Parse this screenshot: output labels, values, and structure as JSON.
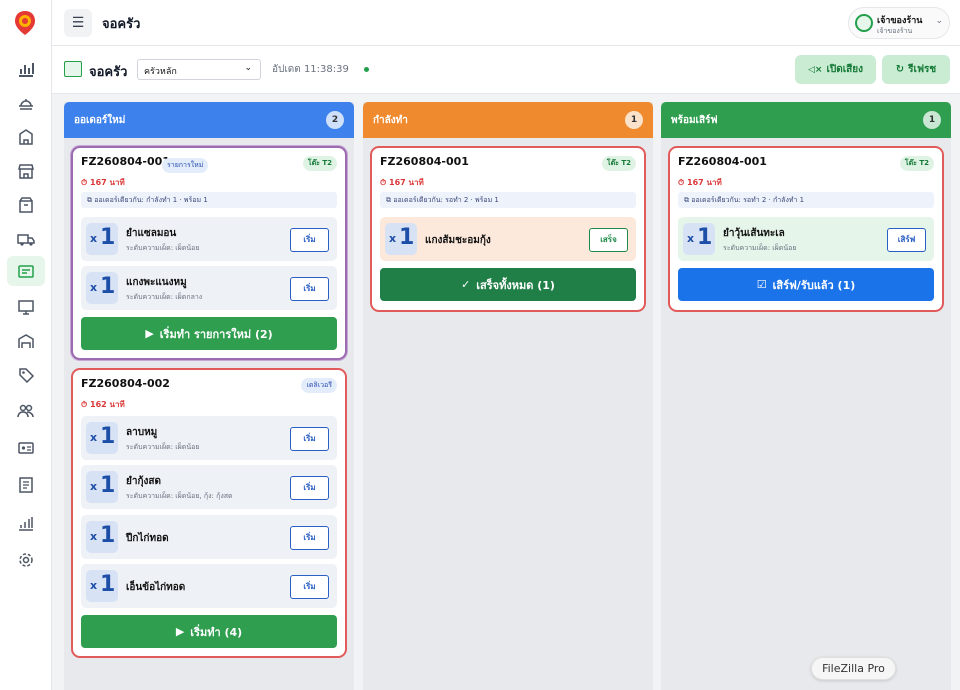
{
  "header": {
    "title": "จอครัว",
    "user_name": "เจ้าของร้าน",
    "user_role": "เจ้าของร้าน"
  },
  "toolbar": {
    "title": "จอครัว",
    "kitchen_select": "ครัวหลัก",
    "update_text": "อัปเดต 11:38:39",
    "sound_button": "เปิดเสียง",
    "refresh_button": "รีเฟรช"
  },
  "colors": {
    "new": "#3d82ec",
    "cooking": "#f08a2e",
    "ready": "#2f9e4f"
  },
  "columns": {
    "new": {
      "title": "ออเดอร์ใหม่",
      "count": "2",
      "orders": [
        {
          "number": "FZ260804-001",
          "badge": "รายการใหม่",
          "table": "โต๊ะ T2",
          "time": "167 นาที",
          "shared_note": "ออเดอร์เดียวกัน: กำลังทำ 1 · พร้อม 1",
          "items": [
            {
              "qty": "1",
              "name": "ยำแซลมอน",
              "note": "ระดับความเผ็ด: เผ็ดน้อย",
              "action": "เริ่ม"
            },
            {
              "qty": "1",
              "name": "แกงพะแนงหมู",
              "note": "ระดับความเผ็ด: เผ็ดกลาง",
              "action": "เริ่ม"
            }
          ],
          "main_action": "เริ่มทำ รายการใหม่ (2)"
        },
        {
          "number": "FZ260804-002",
          "badge": "เดลิเวอรี",
          "time": "162 นาที",
          "items": [
            {
              "qty": "1",
              "name": "ลาบหมู",
              "note": "ระดับความเผ็ด: เผ็ดน้อย",
              "action": "เริ่ม"
            },
            {
              "qty": "1",
              "name": "ยำกุ้งสด",
              "note": "ระดับความเผ็ด: เผ็ดน้อย, กุ้ง: กุ้งสด",
              "action": "เริ่ม"
            },
            {
              "qty": "1",
              "name": "ปีกไก่ทอด",
              "action": "เริ่ม"
            },
            {
              "qty": "1",
              "name": "เอ็นข้อไก่ทอด",
              "action": "เริ่ม"
            }
          ],
          "main_action": "เริ่มทำ (4)"
        }
      ]
    },
    "cooking": {
      "title": "กำลังทำ",
      "count": "1",
      "order": {
        "number": "FZ260804-001",
        "table": "โต๊ะ T2",
        "time": "167 นาที",
        "shared_note": "ออเดอร์เดียวกัน: รอทำ 2 · พร้อม 1",
        "item": {
          "qty": "1",
          "name": "แกงส้มชะอมกุ้ง",
          "action": "เสร็จ"
        },
        "main_action": "เสร็จทั้งหมด (1)"
      }
    },
    "ready": {
      "title": "พร้อมเสิร์ฟ",
      "count": "1",
      "order": {
        "number": "FZ260804-001",
        "table": "โต๊ะ T2",
        "time": "167 นาที",
        "shared_note": "ออเดอร์เดียวกัน: รอทำ 2 · กำลังทำ 1",
        "item": {
          "qty": "1",
          "name": "ยำวุ้นเส้นทะเล",
          "note": "ระดับความเผ็ด: เผ็ดน้อย",
          "action": "เสิร์ฟ"
        },
        "main_action": "เสิร์ฟ/รับแล้ว (1)"
      }
    }
  },
  "tooltip": "FileZilla Pro"
}
